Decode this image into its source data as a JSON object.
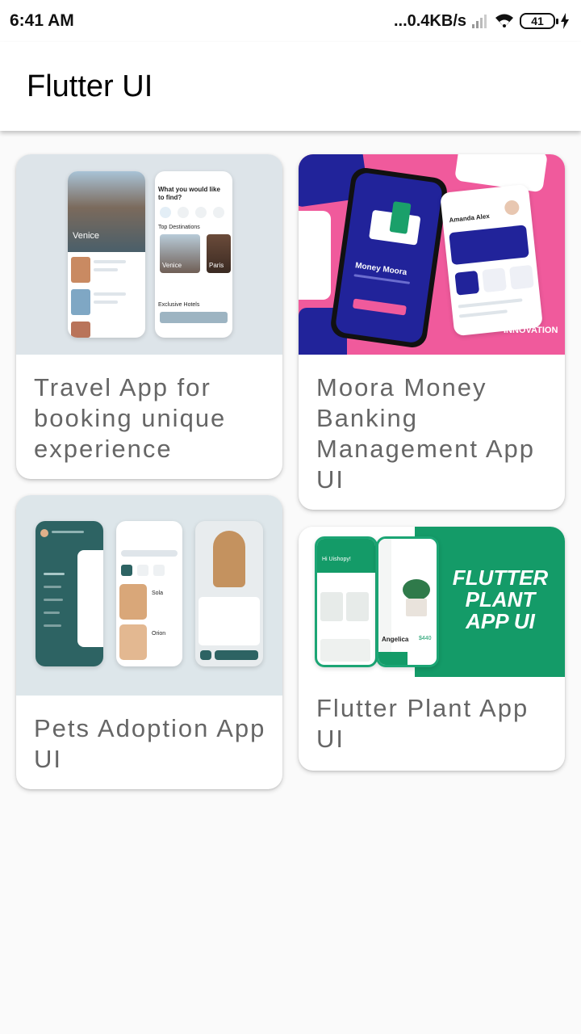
{
  "status": {
    "time": "6:41 AM",
    "network": "...0.4KB/s",
    "battery": "41"
  },
  "appbar": {
    "title": "Flutter UI"
  },
  "cards": [
    {
      "title": "Travel App for booking unique experience",
      "image_alt": "Travel app screens"
    },
    {
      "title": "Moora Money Banking Management App UI",
      "image_alt": "Moora Money app screens"
    },
    {
      "title": "Pets Adoption App UI",
      "image_alt": "Pets adoption app screens"
    },
    {
      "title": "Flutter Plant App UI",
      "image_alt": "Flutter plant app screens"
    }
  ],
  "travel_mock": {
    "hero_city": "Venice",
    "heading": "What you would like to find?",
    "section": "Top Destinations",
    "dest1": "Venice",
    "dest2": "Paris",
    "section2": "Exclusive Hotels"
  },
  "moora_mock": {
    "brand": "Money Moora",
    "name": "Amanda Alex",
    "logo": "INNOVATION"
  },
  "plant_mock": {
    "banner_line1": "FLUTTER",
    "banner_line2": "PLANT",
    "banner_line3": "APP UI",
    "greeting": "Hi Uishopy!",
    "plant_name": "Angelica",
    "price": "$440"
  },
  "pets_mock": {
    "pet_name": "Sola",
    "pet2": "Orion"
  },
  "colors": {
    "plant_green": "#149b68",
    "moora_pink": "#f05a9c",
    "moora_navy": "#21239a",
    "pets_teal": "#2d6363"
  }
}
